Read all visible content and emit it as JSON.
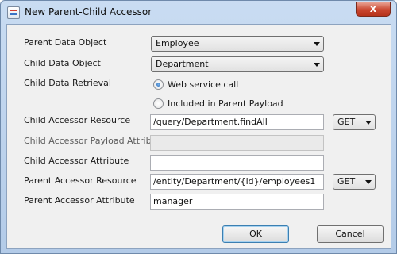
{
  "window": {
    "title": "New Parent-Child Accessor",
    "close_glyph": "x"
  },
  "form": {
    "parent_data_object": {
      "label": "Parent Data Object",
      "value": "Employee"
    },
    "child_data_object": {
      "label": "Child Data Object",
      "value": "Department"
    },
    "child_data_retrieval": {
      "label": "Child Data Retrieval",
      "options": [
        "Web service call",
        "Included in Parent Payload"
      ],
      "selected": "Web service call"
    },
    "child_accessor_resource": {
      "label": "Child Accessor Resource",
      "value": "/query/Department.findAll",
      "method": "GET"
    },
    "child_accessor_payload_attribute": {
      "label": "Child Accessor Payload Attribute",
      "value": ""
    },
    "child_accessor_attribute": {
      "label": "Child Accessor Attribute",
      "value": ""
    },
    "parent_accessor_resource": {
      "label": "Parent Accessor Resource",
      "value": "/entity/Department/{id}/employees1",
      "method": "GET"
    },
    "parent_accessor_attribute": {
      "label": "Parent Accessor Attribute",
      "value": "manager"
    }
  },
  "buttons": {
    "ok": "OK",
    "cancel": "Cancel"
  },
  "icons": {
    "app": "app-window-icon",
    "close": "close-icon",
    "dropdown": "chevron-down-icon"
  }
}
